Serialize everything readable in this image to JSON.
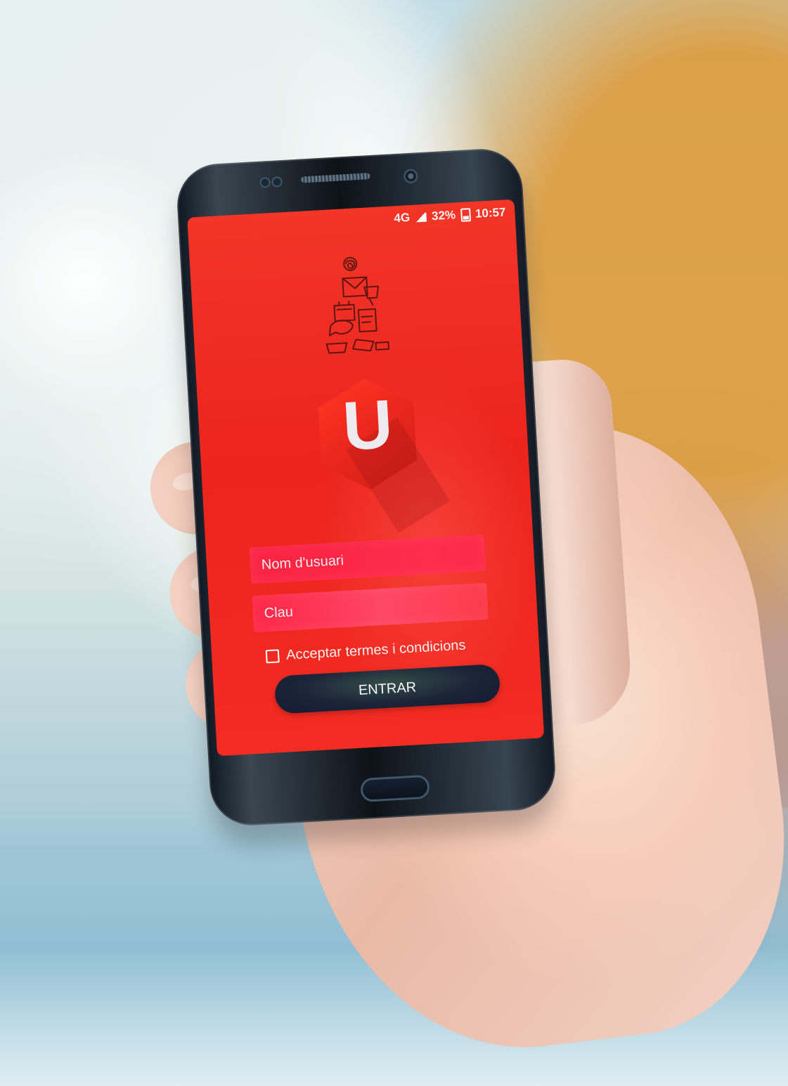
{
  "photo": {
    "description": ""
  },
  "status_bar": {
    "network": "4G",
    "battery_percent": "32%",
    "time": "10:57"
  },
  "app": {
    "logo_letter": "U",
    "username_placeholder": "Nom d'usuari",
    "password_placeholder": "Clau",
    "terms_label": "Acceptar termes i condicions",
    "enter_button": "ENTRAR"
  },
  "icons": {
    "illustration": "communication-doodle-icon",
    "checkbox": "checkbox-icon",
    "home": "home-button-icon"
  },
  "colors": {
    "screen_red": "#e8251f",
    "field_pink": "#ff2656",
    "button_navy": "#1b2438",
    "text_white": "#ffffff"
  }
}
